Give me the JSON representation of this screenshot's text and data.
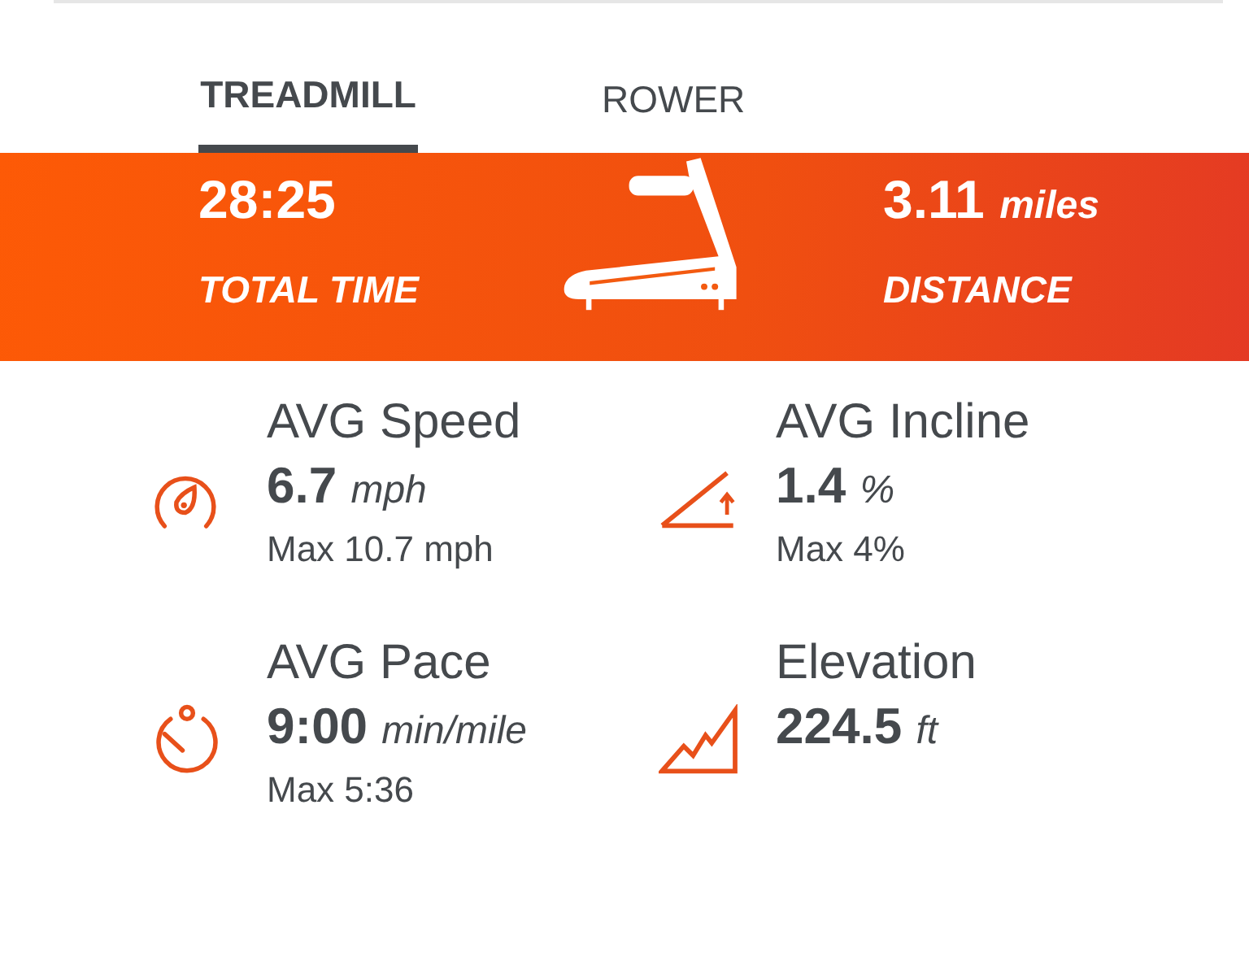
{
  "tabs": [
    {
      "label": "TREADMILL",
      "selected": true
    },
    {
      "label": "ROWER",
      "selected": false
    }
  ],
  "summary": {
    "time": {
      "value": "28:25",
      "label": "TOTAL TIME"
    },
    "distance": {
      "value": "3.11",
      "unit": "miles",
      "label": "DISTANCE"
    }
  },
  "stats": [
    {
      "kind": "speed",
      "title": "AVG Speed",
      "value": "6.7",
      "unit": "mph",
      "max": "Max 10.7 mph"
    },
    {
      "kind": "incline",
      "title": "AVG Incline",
      "value": "1.4",
      "unit": "%",
      "max": "Max 4%"
    },
    {
      "kind": "pace",
      "title": "AVG Pace",
      "value": "9:00",
      "unit": "min/mile",
      "max": "Max 5:36"
    },
    {
      "kind": "elevation",
      "title": "Elevation",
      "value": "224.5",
      "unit": "ft"
    }
  ]
}
